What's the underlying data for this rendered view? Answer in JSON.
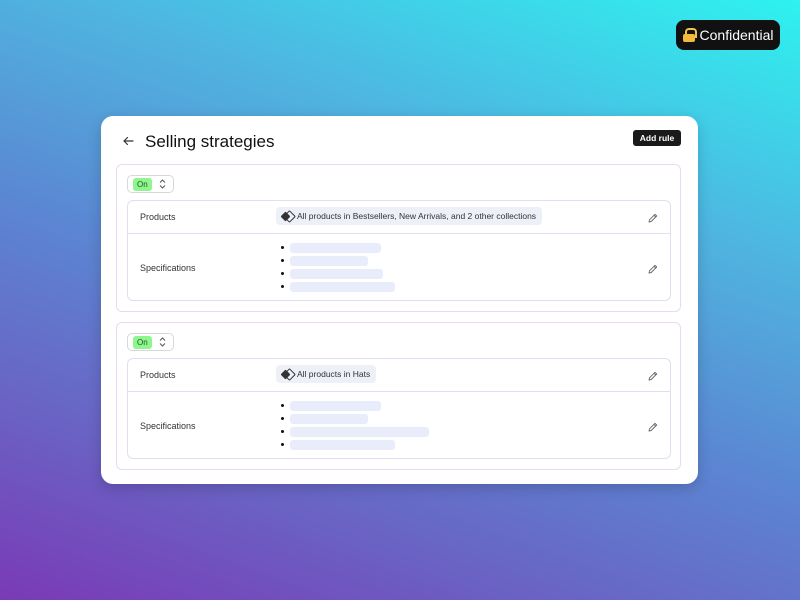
{
  "badge": {
    "label": "Confidential",
    "icon": "lock-icon"
  },
  "header": {
    "title": "Selling strategies",
    "add_rule_label": "Add rule"
  },
  "rules": [
    {
      "status": "On",
      "products_label": "Products",
      "products_value": "All products in Bestsellers, New Arrivals, and 2 other collections",
      "specifications_label": "Specifications",
      "spec_placeholders": 4
    },
    {
      "status": "On",
      "products_label": "Products",
      "products_value": "All products in Hats",
      "specifications_label": "Specifications",
      "spec_placeholders": 4
    }
  ],
  "colors": {
    "accent_toggle": "#8ff58f",
    "button_bg": "#1a1a1a",
    "placeholder_bar": "#e9edfb",
    "border": "#ead9f0"
  }
}
